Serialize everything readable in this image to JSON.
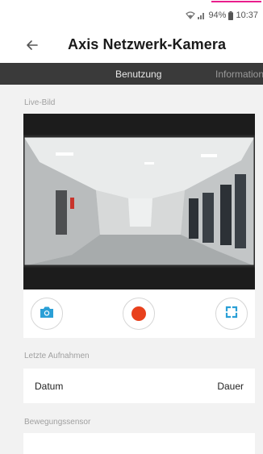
{
  "status_bar": {
    "battery": "94%",
    "time": "10:37",
    "icons": [
      "wifi-icon",
      "signal-icon",
      "battery-icon"
    ]
  },
  "app_bar": {
    "title": "Axis Netzwerk-Kamera",
    "back_icon": "arrow-left-icon"
  },
  "tabs": [
    {
      "label": "Benutzung",
      "active": true
    },
    {
      "label": "Information",
      "active": false
    }
  ],
  "live_view": {
    "label": "Live-Bild",
    "controls": [
      {
        "name": "snapshot",
        "icon": "camera-icon"
      },
      {
        "name": "record",
        "icon": "record-icon"
      },
      {
        "name": "fullscreen",
        "icon": "fullscreen-icon"
      }
    ]
  },
  "recordings": {
    "label": "Letzte Aufnahmen",
    "column_date": "Datum",
    "column_duration": "Dauer"
  },
  "motion_sensor": {
    "label": "Bewegungssensor"
  },
  "colors": {
    "accent": "#2a9fd6",
    "record": "#e8401c",
    "tab_bar": "#3a3a3a"
  }
}
